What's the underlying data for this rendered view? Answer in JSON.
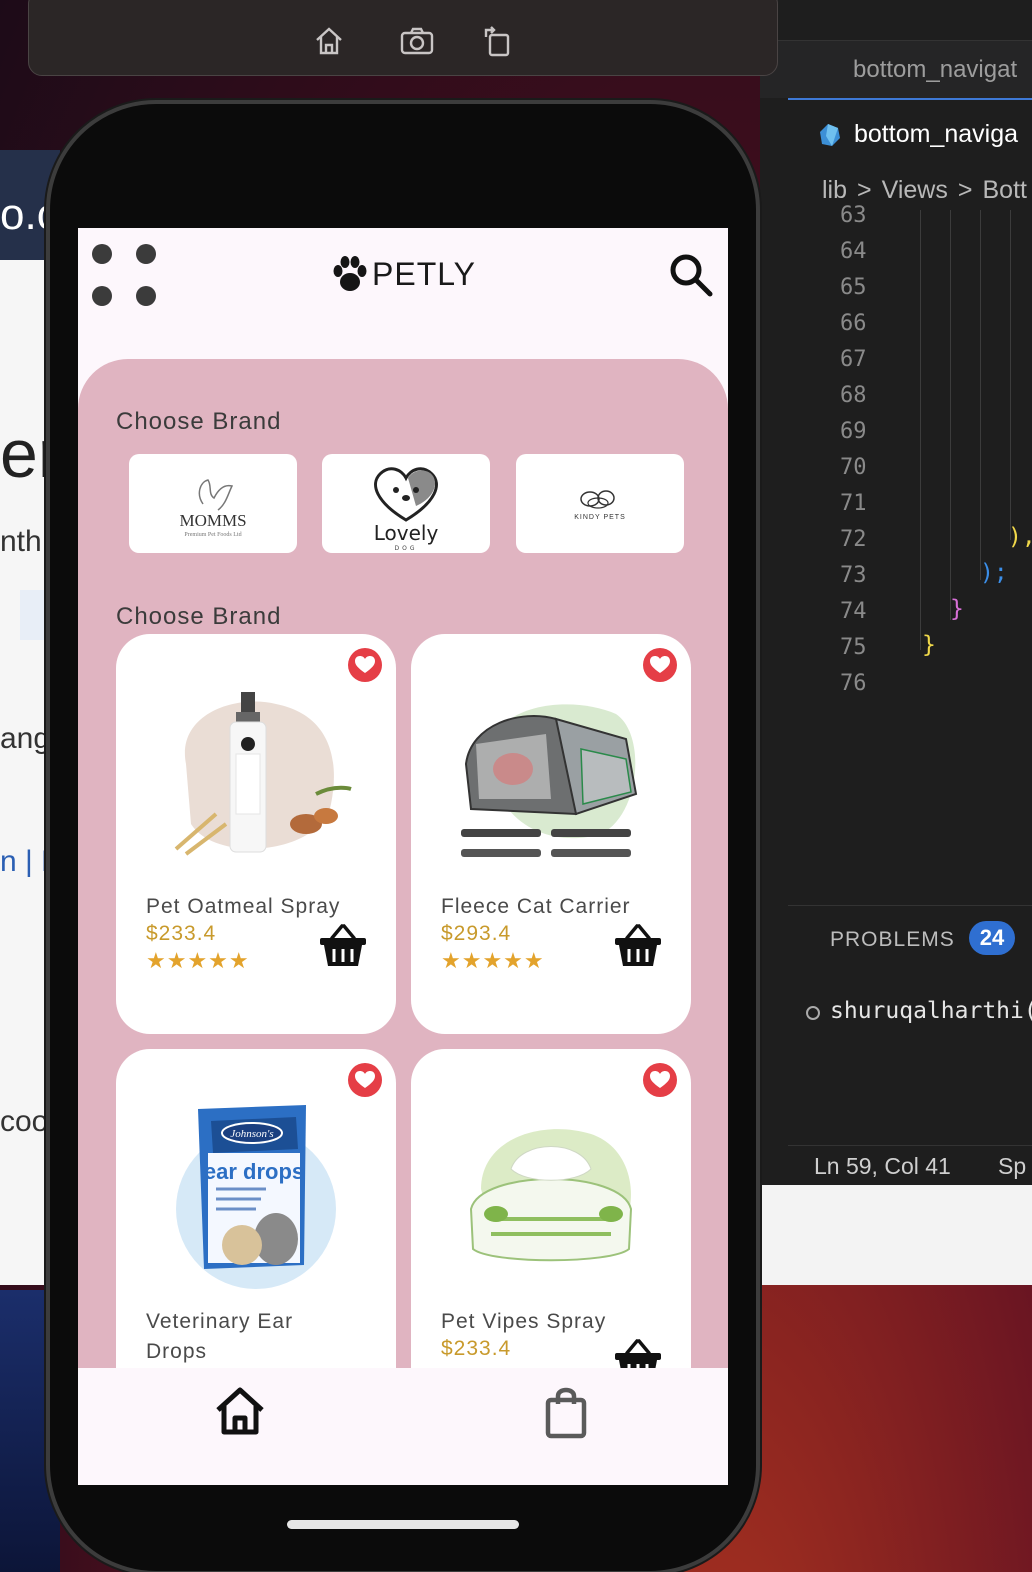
{
  "editor": {
    "tab_label": "bottom_navigat",
    "active_tab_label": "bottom_naviga",
    "breadcrumb": [
      "lib",
      ">",
      "Views",
      ">",
      "Bott"
    ],
    "line_numbers": [
      "63",
      "64",
      "65",
      "66",
      "67",
      "68",
      "69",
      "70",
      "71",
      "72",
      "73",
      "74",
      "75",
      "76"
    ],
    "problems_label": "PROBLEMS",
    "problems_count": "24",
    "terminal_user": "shuruqalharthi(",
    "status_position": "Ln 59, Col 41",
    "status_spaces": "Sp"
  },
  "browser_fragments": {
    "f1": "o.c",
    "f2": "er",
    "f3": "nth",
    "f4": "ang",
    "f5": "n | P",
    "f6": "coo"
  },
  "app": {
    "brand_name": "PETLY",
    "section_brands_title": "Choose Brand",
    "section_products_title": "Choose Brand",
    "brands": [
      {
        "logo_text": "MOMMS",
        "logo_sub": "Premium Pet Foods Ltd"
      },
      {
        "logo_text": "Lovely",
        "logo_sub": "DOG"
      },
      {
        "logo_text": "KINDY PETS"
      }
    ],
    "products": [
      {
        "name": "Pet Oatmeal Spray",
        "price": "$233.4",
        "stars": "★★★★★"
      },
      {
        "name": "Fleece Cat Carrier",
        "price": "$293.4",
        "stars": "★★★★★"
      },
      {
        "name": "Veterinary Ear Drops",
        "package_text": "ear drops",
        "brand_badge": "Johnson's"
      },
      {
        "name": "Pet Vipes Spray",
        "price": "$233.4"
      }
    ]
  },
  "colors": {
    "accent_pink": "#e0b4c1",
    "favorite_red": "#e53e46",
    "price_gold": "#c89a2c",
    "star_gold": "#e3a32c",
    "problems_badge": "#2f6fd1"
  },
  "icons": [
    "home-icon",
    "camera-icon",
    "rotate-icon",
    "menu-grid-icon",
    "paw-icon",
    "search-icon",
    "heart-icon",
    "cart-basket-icon",
    "home-nav-icon",
    "shopping-bag-icon",
    "dart-file-icon"
  ]
}
